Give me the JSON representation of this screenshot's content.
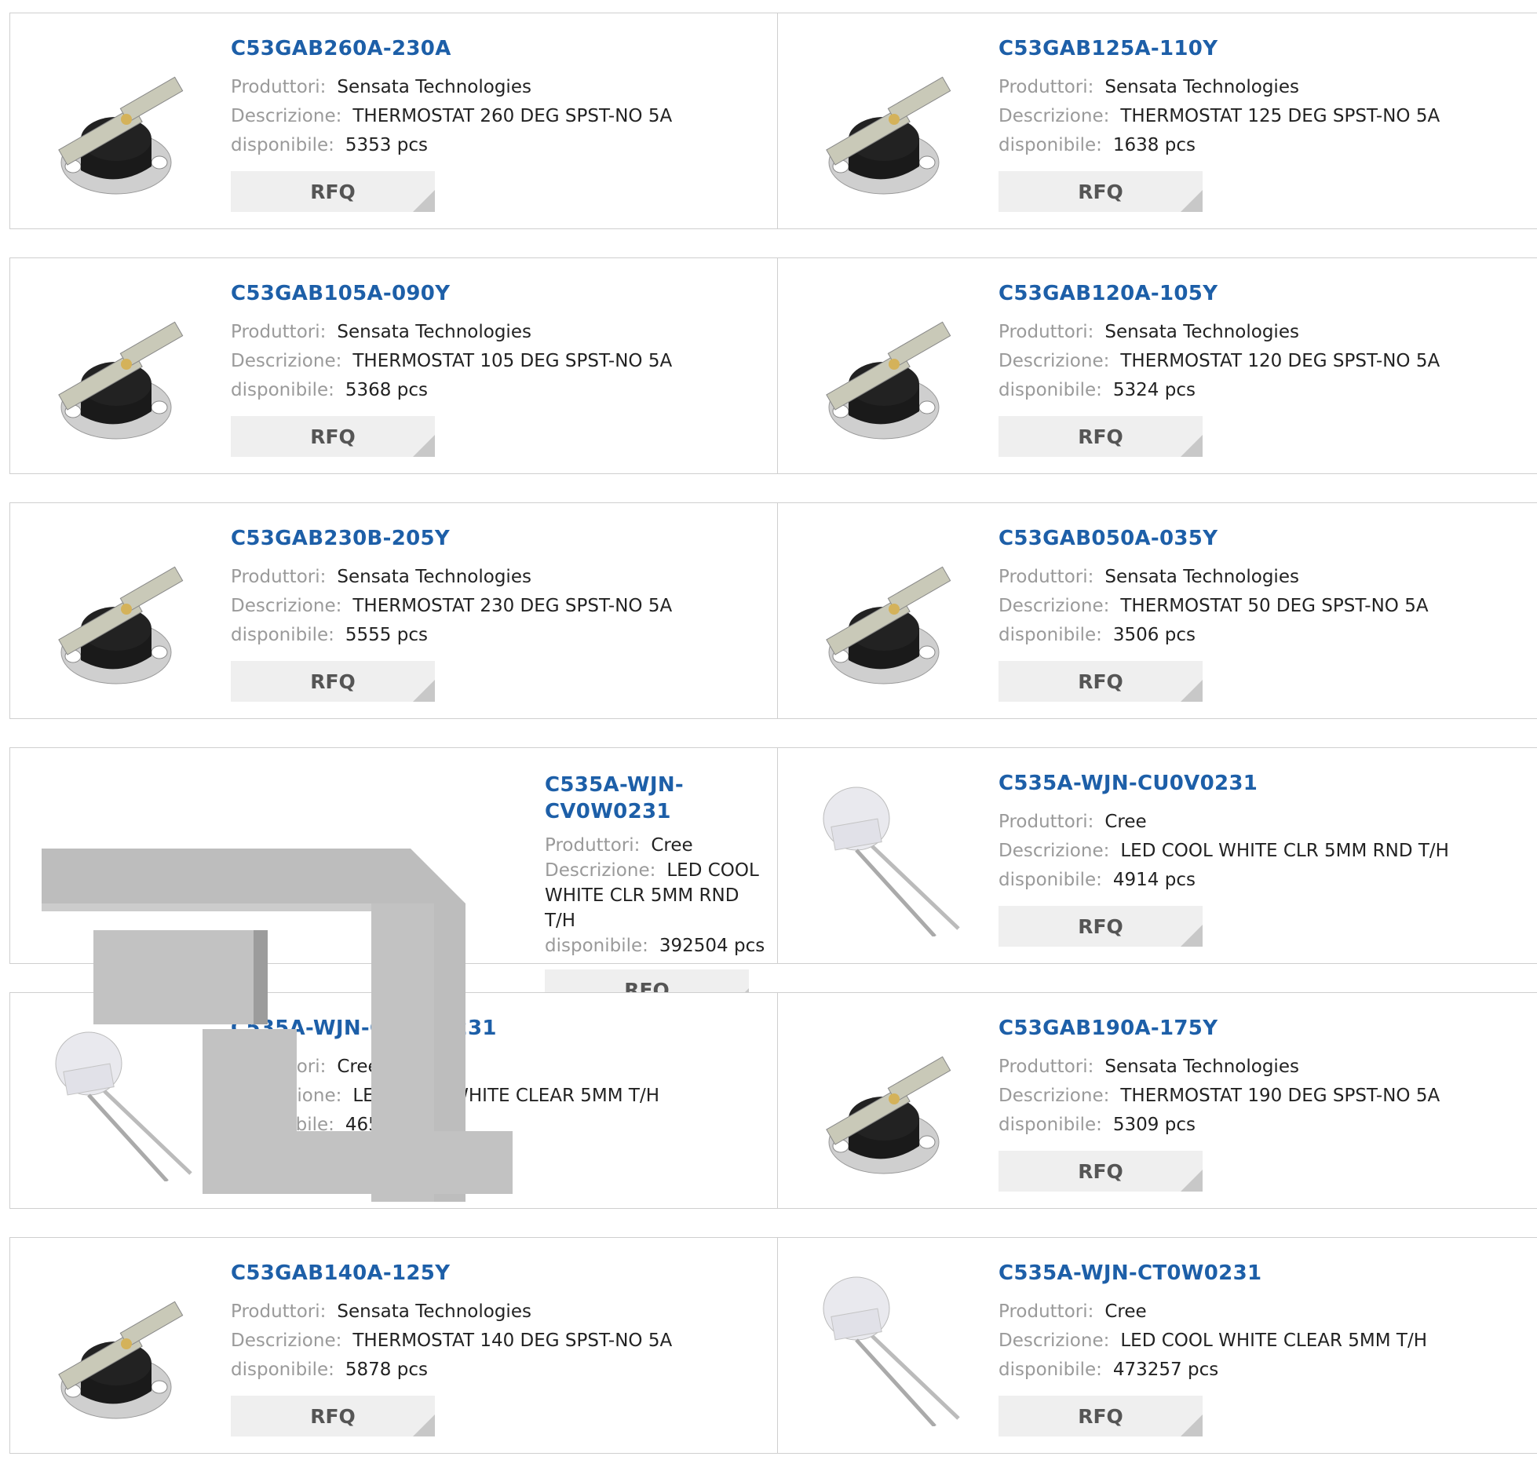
{
  "labels": {
    "manufacturer": "Produttori:",
    "description": "Descrizione:",
    "available": "disponibile:",
    "rfq": "RFQ"
  },
  "products": [
    {
      "pn": "C53GAB260A-230A",
      "manufacturer": "Sensata Technologies",
      "description": "THERMOSTAT 260 DEG SPST-NO 5A",
      "available": "5353 pcs",
      "image": "thermostat-icon"
    },
    {
      "pn": "C53GAB125A-110Y",
      "manufacturer": "Sensata Technologies",
      "description": "THERMOSTAT 125 DEG SPST-NO 5A",
      "available": "1638 pcs",
      "image": "thermostat-icon"
    },
    {
      "pn": "C53GAB105A-090Y",
      "manufacturer": "Sensata Technologies",
      "description": "THERMOSTAT 105 DEG SPST-NO 5A",
      "available": "5368 pcs",
      "image": "thermostat-icon"
    },
    {
      "pn": "C53GAB120A-105Y",
      "manufacturer": "Sensata Technologies",
      "description": "THERMOSTAT 120 DEG SPST-NO 5A",
      "available": "5324 pcs",
      "image": "thermostat-icon"
    },
    {
      "pn": "C53GAB230B-205Y",
      "manufacturer": "Sensata Technologies",
      "description": "THERMOSTAT 230 DEG SPST-NO 5A",
      "available": "5555 pcs",
      "image": "thermostat-icon"
    },
    {
      "pn": "C53GAB050A-035Y",
      "manufacturer": "Sensata Technologies",
      "description": "THERMOSTAT 50 DEG SPST-NO 5A",
      "available": "3506 pcs",
      "image": "thermostat-icon"
    },
    {
      "pn": "C535A-WJN-CV0W0231",
      "manufacturer": "Cree",
      "description": "LED COOL WHITE CLR 5MM RND T/H",
      "available": "392504 pcs",
      "image": "large-bracket-image"
    },
    {
      "pn": "C535A-WJN-CU0V0231",
      "manufacturer": "Cree",
      "description": "LED COOL WHITE CLR 5MM RND T/H",
      "available": "4914 pcs",
      "image": "led-icon"
    },
    {
      "pn": "C535A-WJN-CU0W0231",
      "manufacturer": "Cree",
      "description": "LED COOL WHITE CLEAR 5MM T/H",
      "available": "465291 pcs",
      "image": "led-icon"
    },
    {
      "pn": "C53GAB190A-175Y",
      "manufacturer": "Sensata Technologies",
      "description": "THERMOSTAT 190 DEG SPST-NO 5A",
      "available": "5309 pcs",
      "image": "thermostat-icon"
    },
    {
      "pn": "C53GAB140A-125Y",
      "manufacturer": "Sensata Technologies",
      "description": "THERMOSTAT 140 DEG SPST-NO 5A",
      "available": "5878 pcs",
      "image": "thermostat-icon"
    },
    {
      "pn": "C535A-WJN-CT0W0231",
      "manufacturer": "Cree",
      "description": "LED COOL WHITE CLEAR 5MM T/H",
      "available": "473257 pcs",
      "image": "led-icon"
    }
  ],
  "colors": {
    "link": "#1d5fa8",
    "label": "#9a9a9a",
    "button_bg": "#efefef",
    "border": "#cfcfcf"
  }
}
